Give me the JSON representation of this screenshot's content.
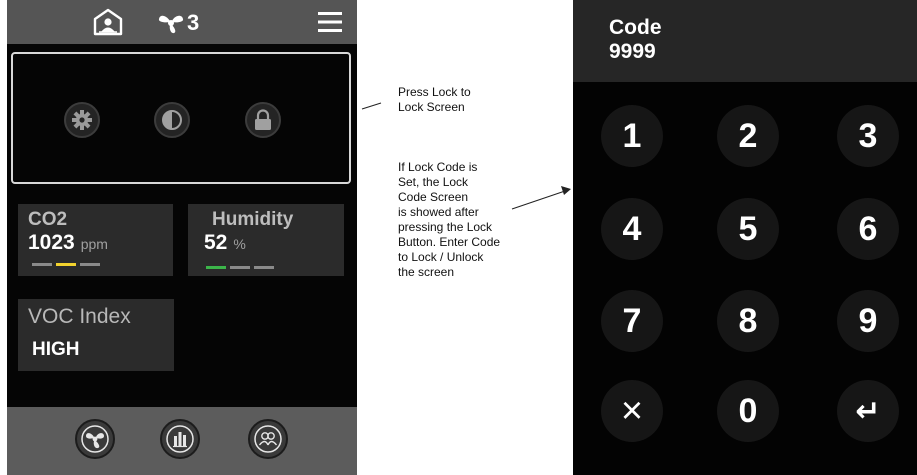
{
  "device": {
    "icons": {
      "home": "home-user-icon",
      "fan": "fan-icon",
      "menu": "hamburger-menu-icon"
    },
    "fan_level": "3",
    "quick_actions": [
      {
        "name": "settings",
        "icon": "gear-icon"
      },
      {
        "name": "contrast",
        "icon": "contrast-icon"
      },
      {
        "name": "lock",
        "icon": "padlock-icon"
      }
    ],
    "tiles": {
      "co2": {
        "label": "CO2",
        "value": "1023",
        "unit": "ppm",
        "level_bars": [
          "#8a8a8a",
          "#f2d22e",
          "#8a8a8a"
        ]
      },
      "humidity": {
        "label": "Humidity",
        "value": "52",
        "unit": "%",
        "level_bars": [
          "#3cb54a",
          "#8a8a8a",
          "#8a8a8a"
        ]
      },
      "voc": {
        "label": "VOC Index",
        "value": "HIGH"
      }
    },
    "bottom_nav": [
      {
        "name": "fan",
        "icon": "fan-icon"
      },
      {
        "name": "charts",
        "icon": "bar-chart-icon"
      },
      {
        "name": "users",
        "icon": "users-icon"
      }
    ]
  },
  "annotations": {
    "lock_note": [
      "Press Lock to",
      "Lock Screen"
    ],
    "code_note": [
      "If Lock Code is",
      "Set, the Lock",
      "Code Screen",
      "is showed after",
      "pressing the Lock",
      "Button. Enter Code",
      "to Lock / Unlock",
      "the screen"
    ]
  },
  "keypad": {
    "code_label": "Code",
    "code_value": "9999",
    "keys": [
      "1",
      "2",
      "3",
      "4",
      "5",
      "6",
      "7",
      "8",
      "9",
      "×",
      "0",
      "↵"
    ]
  },
  "colors": {
    "screen_bg": "#050505",
    "bar_bg": "#555555",
    "tile_bg": "#2b2b2b",
    "key_bg": "#161616"
  }
}
